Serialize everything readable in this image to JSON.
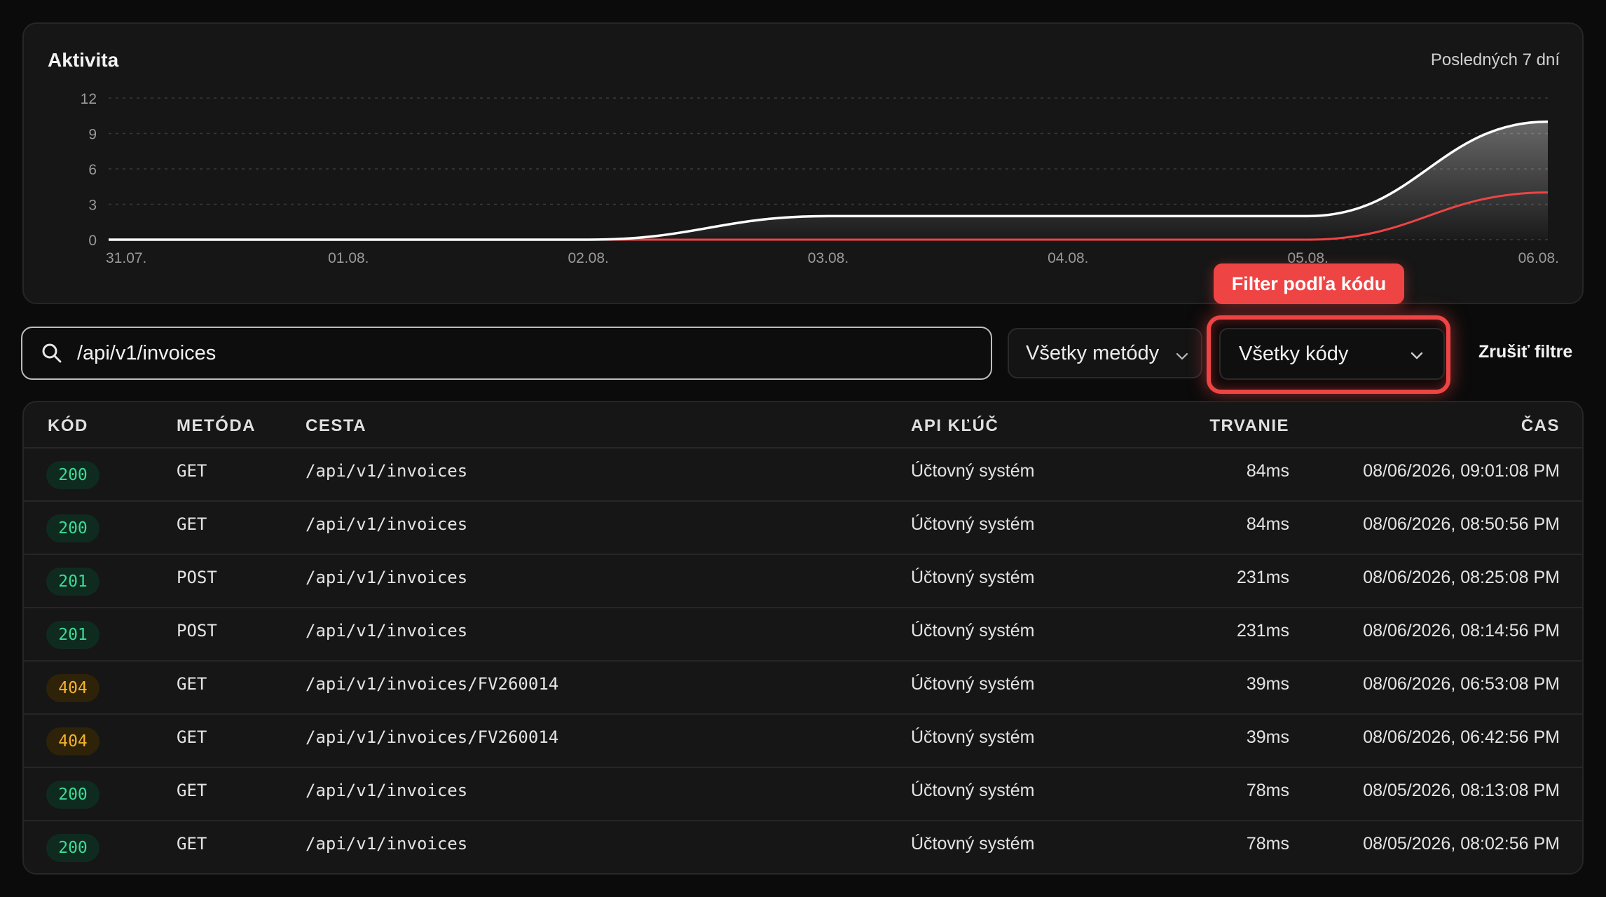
{
  "activity": {
    "title": "Aktivita",
    "range_label": "Posledných 7 dní"
  },
  "chart_data": {
    "type": "area",
    "x": [
      "31.07.",
      "01.08.",
      "02.08.",
      "03.08.",
      "04.08.",
      "05.08.",
      "06.08."
    ],
    "ylim": [
      0,
      12
    ],
    "yticks": [
      "0",
      "3",
      "6",
      "9",
      "12"
    ],
    "grid": true,
    "series": [
      {
        "values": [
          0,
          0,
          0,
          2,
          2,
          2,
          10
        ],
        "color": "#ffffff"
      },
      {
        "values": [
          0,
          0,
          0,
          0,
          0,
          0,
          4
        ],
        "color": "#ef4444"
      }
    ]
  },
  "filters": {
    "search_value": "/api/v1/invoices",
    "methods_label": "Všetky metódy",
    "codes_label": "Všetky kódy",
    "tooltip": "Filter podľa kódu",
    "clear_label": "Zrušiť filtre"
  },
  "table": {
    "headers": {
      "code": "KÓD",
      "method": "METÓDA",
      "path": "CESTA",
      "key": "API KĽÚČ",
      "duration": "TRVANIE",
      "time": "ČAS"
    },
    "rows": [
      {
        "code": "200",
        "status": "ok",
        "method": "GET",
        "path": "/api/v1/invoices",
        "key": "Účtovný systém",
        "duration": "84ms",
        "time": "08/06/2026, 09:01:08 PM"
      },
      {
        "code": "200",
        "status": "ok",
        "method": "GET",
        "path": "/api/v1/invoices",
        "key": "Účtovný systém",
        "duration": "84ms",
        "time": "08/06/2026, 08:50:56 PM"
      },
      {
        "code": "201",
        "status": "ok",
        "method": "POST",
        "path": "/api/v1/invoices",
        "key": "Účtovný systém",
        "duration": "231ms",
        "time": "08/06/2026, 08:25:08 PM"
      },
      {
        "code": "201",
        "status": "ok",
        "method": "POST",
        "path": "/api/v1/invoices",
        "key": "Účtovný systém",
        "duration": "231ms",
        "time": "08/06/2026, 08:14:56 PM"
      },
      {
        "code": "404",
        "status": "warn",
        "method": "GET",
        "path": "/api/v1/invoices/FV260014",
        "key": "Účtovný systém",
        "duration": "39ms",
        "time": "08/06/2026, 06:53:08 PM"
      },
      {
        "code": "404",
        "status": "warn",
        "method": "GET",
        "path": "/api/v1/invoices/FV260014",
        "key": "Účtovný systém",
        "duration": "39ms",
        "time": "08/06/2026, 06:42:56 PM"
      },
      {
        "code": "200",
        "status": "ok",
        "method": "GET",
        "path": "/api/v1/invoices",
        "key": "Účtovný systém",
        "duration": "78ms",
        "time": "08/05/2026, 08:13:08 PM"
      },
      {
        "code": "200",
        "status": "ok",
        "method": "GET",
        "path": "/api/v1/invoices",
        "key": "Účtovný systém",
        "duration": "78ms",
        "time": "08/05/2026, 08:02:56 PM"
      }
    ]
  }
}
